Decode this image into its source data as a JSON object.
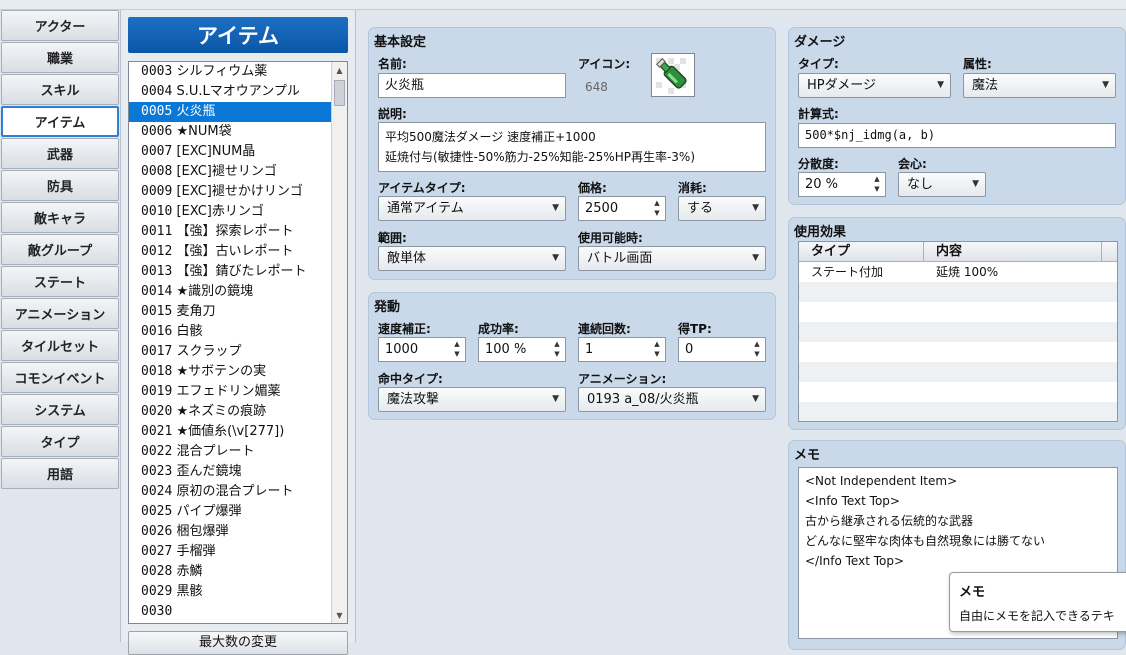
{
  "nav": [
    "アクター",
    "職業",
    "スキル",
    "アイテム",
    "武器",
    "防具",
    "敵キャラ",
    "敵グループ",
    "ステート",
    "アニメーション",
    "タイルセット",
    "コモンイベント",
    "システム",
    "タイプ",
    "用語"
  ],
  "nav_active": "アイテム",
  "list": {
    "header": "アイテム",
    "items": [
      {
        "id": "0003",
        "name": "シルフィウム薬"
      },
      {
        "id": "0004",
        "name": "S.U.Lマオウアンプル"
      },
      {
        "id": "0005",
        "name": "火炎瓶"
      },
      {
        "id": "0006",
        "name": "★NUM袋"
      },
      {
        "id": "0007",
        "name": "[EXC]NUM晶"
      },
      {
        "id": "0008",
        "name": "[EXC]褪せリンゴ"
      },
      {
        "id": "0009",
        "name": "[EXC]褪せかけリンゴ"
      },
      {
        "id": "0010",
        "name": "[EXC]赤リンゴ"
      },
      {
        "id": "0011",
        "name": "【強】探索レポート"
      },
      {
        "id": "0012",
        "name": "【強】古いレポート"
      },
      {
        "id": "0013",
        "name": "【強】錆びたレポート"
      },
      {
        "id": "0014",
        "name": "★識別の鏡塊"
      },
      {
        "id": "0015",
        "name": "麦角刀"
      },
      {
        "id": "0016",
        "name": "白骸"
      },
      {
        "id": "0017",
        "name": "スクラップ"
      },
      {
        "id": "0018",
        "name": "★サボテンの実"
      },
      {
        "id": "0019",
        "name": "エフェドリン媚薬"
      },
      {
        "id": "0020",
        "name": "★ネズミの痕跡"
      },
      {
        "id": "0021",
        "name": "★価値糸(\\v[277])"
      },
      {
        "id": "0022",
        "name": "混合プレート"
      },
      {
        "id": "0023",
        "name": "歪んだ鏡塊"
      },
      {
        "id": "0024",
        "name": "原初の混合プレート"
      },
      {
        "id": "0025",
        "name": "パイプ爆弾"
      },
      {
        "id": "0026",
        "name": "梱包爆弾"
      },
      {
        "id": "0027",
        "name": "手榴弾"
      },
      {
        "id": "0028",
        "name": "赤鱗"
      },
      {
        "id": "0029",
        "name": "黒骸"
      },
      {
        "id": "0030",
        "name": ""
      }
    ],
    "selected_id": "0005",
    "change_max_label": "最大数の変更"
  },
  "basic": {
    "title": "基本設定",
    "name_label": "名前:",
    "name_value": "火炎瓶",
    "icon_label": "アイコン:",
    "icon_index": "648",
    "desc_label": "説明:",
    "desc_line1": "平均500魔法ダメージ 速度補正+1000",
    "desc_line2": "延焼付与(敏捷性-50%筋力-25%知能-25%HP再生率-3%)",
    "itemtype_label": "アイテムタイプ:",
    "itemtype_value": "通常アイテム",
    "price_label": "価格:",
    "price_value": "2500",
    "consume_label": "消耗:",
    "consume_value": "する",
    "scope_label": "範囲:",
    "scope_value": "敵単体",
    "occasion_label": "使用可能時:",
    "occasion_value": "バトル画面"
  },
  "invocation": {
    "title": "発動",
    "speed_label": "速度補正:",
    "speed_value": "1000",
    "success_label": "成功率:",
    "success_value": "100 %",
    "repeat_label": "連続回数:",
    "repeat_value": "1",
    "tp_label": "得TP:",
    "tp_value": "0",
    "hittype_label": "命中タイプ:",
    "hittype_value": "魔法攻撃",
    "anim_label": "アニメーション:",
    "anim_value": "0193 a_08/火炎瓶"
  },
  "damage": {
    "title": "ダメージ",
    "type_label": "タイプ:",
    "type_value": "HPダメージ",
    "element_label": "属性:",
    "element_value": "魔法",
    "formula_label": "計算式:",
    "formula_value": "500*$nj_idmg(a, b)",
    "variance_label": "分散度:",
    "variance_value": "20 %",
    "critical_label": "会心:",
    "critical_value": "なし"
  },
  "effects": {
    "title": "使用効果",
    "col_type": "タイプ",
    "col_content": "内容",
    "rows": [
      {
        "type": "ステート付加",
        "content": "延焼 100%"
      }
    ]
  },
  "memo": {
    "title": "メモ",
    "lines": [
      "<Not Independent Item>",
      "<Info Text Top>",
      "古から継承される伝統的な武器",
      "どんなに堅牢な肉体も自然現象には勝てない",
      "</Info Text Top>"
    ]
  },
  "tooltip": {
    "title": "メモ",
    "text": "自由にメモを記入できるテキ"
  },
  "colors": {
    "accent": "#0a78d7",
    "header": "#0a57a8",
    "panel": "#c9d9ea"
  },
  "icons": {
    "item_icon": "bottle-icon"
  }
}
